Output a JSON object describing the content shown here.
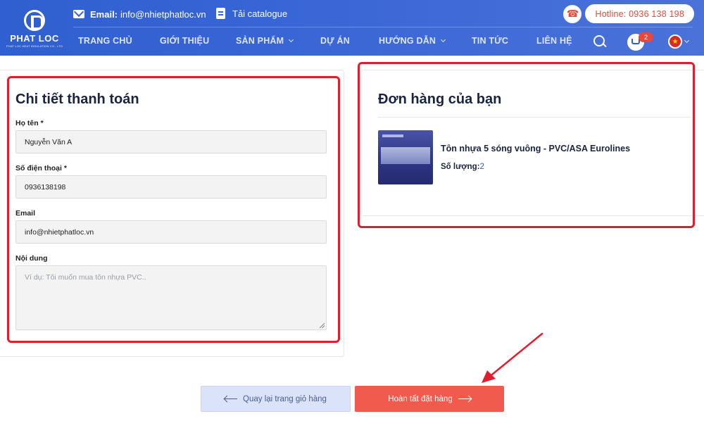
{
  "header": {
    "logo_text": "PHAT LOC",
    "logo_sub": "PHAT LOC HEAT INSULATION CO., LTD",
    "email_label": "Email:",
    "email_value": "info@nhietphatloc.vn",
    "catalogue_label": "Tải catalogue",
    "hotline": "Hotline: 0936 138 198",
    "cart_count": "2",
    "language": "vi"
  },
  "nav": {
    "items": [
      {
        "label": "TRANG CHỦ",
        "has_dropdown": false
      },
      {
        "label": "GIỚI THIỆU",
        "has_dropdown": false
      },
      {
        "label": "SẢN PHẨM",
        "has_dropdown": true
      },
      {
        "label": "DỰ ÁN",
        "has_dropdown": false
      },
      {
        "label": "HƯỚNG DẪN",
        "has_dropdown": true
      },
      {
        "label": "TIN TỨC",
        "has_dropdown": false
      },
      {
        "label": "LIÊN HỆ",
        "has_dropdown": false
      }
    ]
  },
  "billing": {
    "title": "Chi tiết thanh toán",
    "name_label": "Họ tên *",
    "name_value": "Nguyễn Văn A",
    "phone_label": "Số điện thoại *",
    "phone_value": "0936138198",
    "email_label": "Email",
    "email_value": "info@nhietphatloc.vn",
    "content_label": "Nội dung",
    "content_placeholder": "Ví dụ: Tôi muốn mua tôn nhựa PVC.."
  },
  "order": {
    "title": "Đơn hàng của bạn",
    "product_name": "Tôn nhựa 5 sóng vuông - PVC/ASA Eurolines",
    "qty_label": "Số lượng:",
    "qty_value": "2"
  },
  "actions": {
    "back_label": "Quay lại trang giỏ hàng",
    "complete_label": "Hoàn tất đặt hàng"
  },
  "colors": {
    "header_blue": "#3a66d6",
    "accent_red": "#e8483b",
    "button_red": "#f05b4d",
    "annotation_red": "#e01e2e"
  }
}
